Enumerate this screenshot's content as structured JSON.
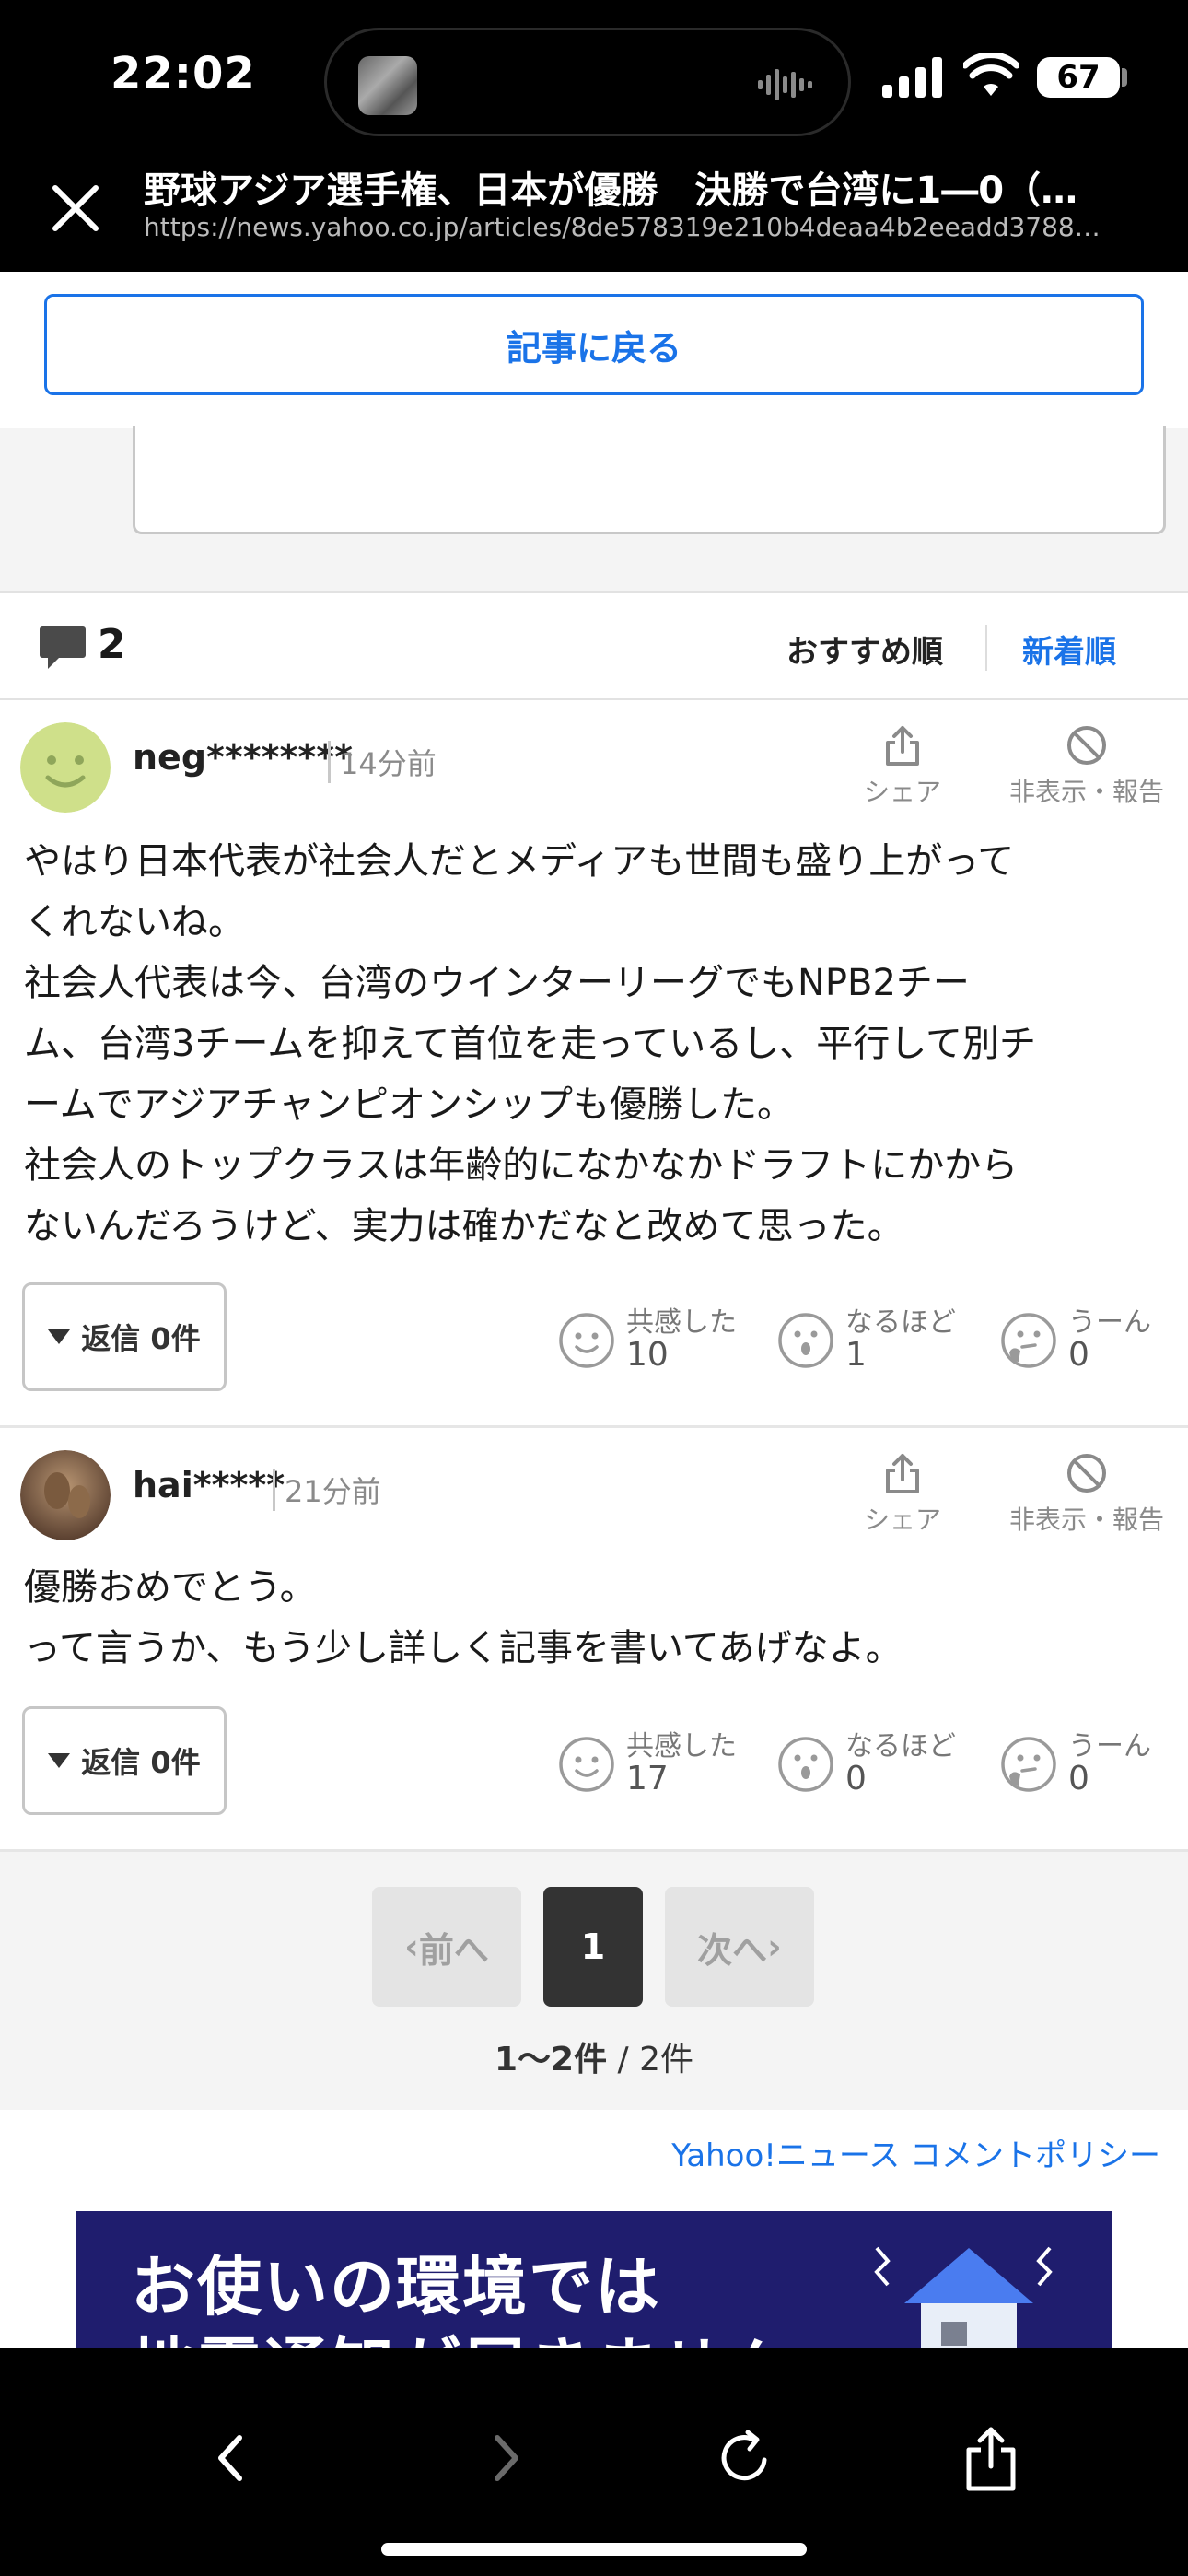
{
  "status": {
    "time": "22:02",
    "battery": "67"
  },
  "browser": {
    "title": "野球アジア選手権、日本が優勝　決勝で台湾に1―0（…",
    "url": "https://news.yahoo.co.jp/articles/8de578319e210b4deaa4b2eeadd3788…"
  },
  "back_button": "記事に戻る",
  "comments_header": {
    "count": "2",
    "sort_recommended": "おすすめ順",
    "sort_new": "新着順"
  },
  "actions": {
    "share": "シェア",
    "hide_report": "非表示・報告"
  },
  "reactions": {
    "empathy": "共感した",
    "indeed": "なるほど",
    "hmm": "うーん"
  },
  "comments": [
    {
      "user": "neg********",
      "time": "14分前",
      "body": "やはり日本代表が社会人だとメディアも世間も盛り上がって\nくれないね。\n社会人代表は今、台湾のウインターリーグでもNPB2チー\nム、台湾3チームを抑えて首位を走っているし、平行して別チ\nームでアジアチャンピオンシップも優勝した。\n社会人のトップクラスは年齢的になかなかドラフトにかから\nないんだろうけど、実力は確かだなと改めて思った。",
      "reply": "返信 0件",
      "empathy": "10",
      "indeed": "1",
      "hmm": "0"
    },
    {
      "user": "hai*****",
      "time": "21分前",
      "body": "優勝おめでとう。\nって言うか、もう少し詳しく記事を書いてあげなよ。",
      "reply": "返信 0件",
      "empathy": "17",
      "indeed": "0",
      "hmm": "0"
    }
  ],
  "pagination": {
    "prev": "前へ",
    "current": "1",
    "next": "次へ",
    "range_bold": "1〜2件",
    "range_total": " / 2件"
  },
  "policy_link": "Yahoo!ニュース コメントポリシー",
  "ad": {
    "line1": "お使いの環境では",
    "line2": "地震通知が届きません"
  },
  "colors": {
    "accent": "#1a73e8",
    "ad_bg": "#1f1d6e"
  }
}
